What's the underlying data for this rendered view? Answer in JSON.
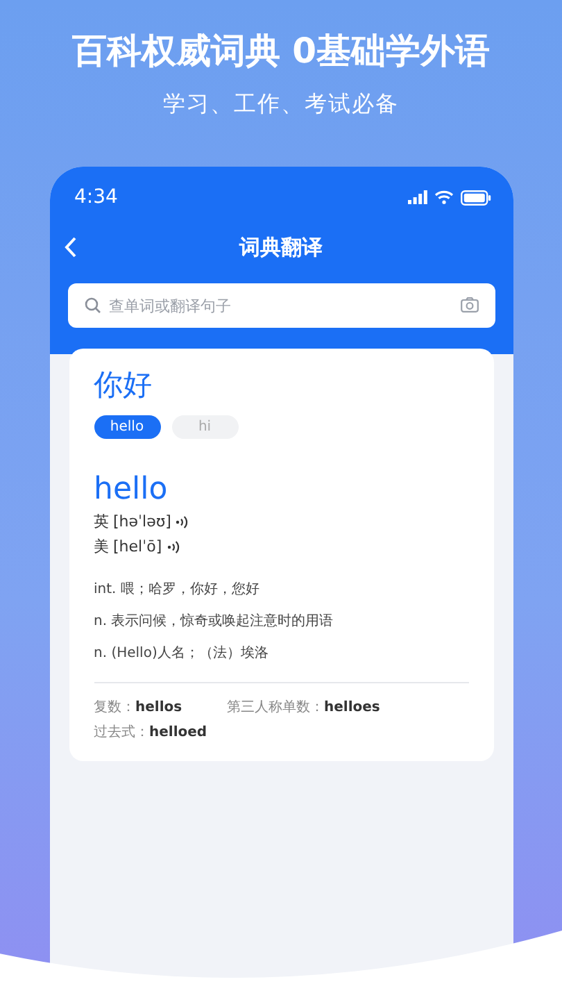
{
  "headline": "百科权威词典 0基础学外语",
  "subtitle": "学习、工作、考试必备",
  "status_bar": {
    "time": "4:34"
  },
  "nav": {
    "title": "词典翻译"
  },
  "search": {
    "placeholder": "查单词或翻译句子"
  },
  "query": "你好",
  "tags": [
    {
      "label": "hello",
      "selected": true
    },
    {
      "label": "hi",
      "selected": false
    }
  ],
  "entry": {
    "word": "hello",
    "pronunciations": [
      {
        "region": "英",
        "phonetic": "[həˈləʊ]"
      },
      {
        "region": "美",
        "phonetic": "[helˈō]"
      }
    ],
    "definitions": [
      "int. 喂；哈罗，你好，您好",
      "n. 表示问候，惊奇或唤起注意时的用语",
      "n. (Hello)人名；（法）埃洛"
    ],
    "forms": [
      "复数：**hellos**",
      "第三人称单数：**helloes**",
      "过去式：**helloed**"
    ]
  }
}
